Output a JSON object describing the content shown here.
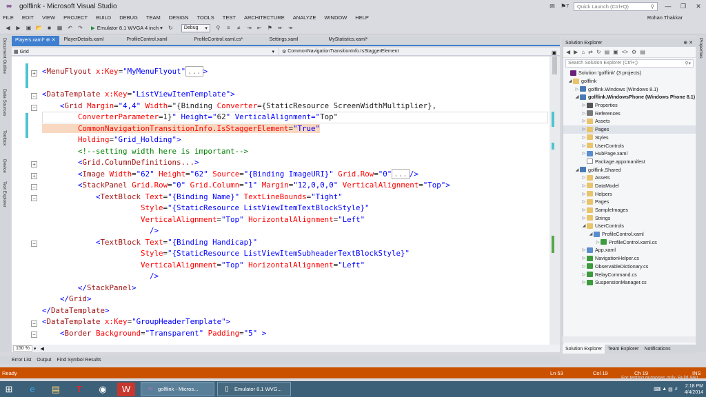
{
  "window": {
    "title": "golflink - Microsoft Visual Studio",
    "quick_launch_placeholder": "Quick Launch (Ctrl+Q)",
    "notification_count": "7",
    "user": "Rohan Thakkar"
  },
  "menu": [
    "FILE",
    "EDIT",
    "VIEW",
    "PROJECT",
    "BUILD",
    "DEBUG",
    "TEAM",
    "DESIGN",
    "TOOLS",
    "TEST",
    "ARCHITECTURE",
    "ANALYZE",
    "WINDOW",
    "HELP"
  ],
  "toolbar": {
    "run_target": "Emulator 8.1 WVGA 4 inch",
    "configuration": "Debug"
  },
  "left_panels": [
    "Document Outline",
    "Data Sources",
    "Toolbox",
    "Device",
    "Test Explorer"
  ],
  "doc_tabs": [
    {
      "label": "Players.xaml*",
      "active": true
    },
    {
      "label": "PlayerDetails.xaml",
      "active": false
    },
    {
      "label": "ProfileControl.xaml",
      "active": false
    },
    {
      "label": "ProfileControl.xaml.cs*",
      "active": false
    },
    {
      "label": "Settings.xaml",
      "active": false
    },
    {
      "label": "MyStatistics.xaml*",
      "active": false
    }
  ],
  "navbar": {
    "element": "Grid",
    "member": "CommonNavigationTransitionInfo.IsStaggerElement"
  },
  "editor": {
    "zoom": "150 %",
    "lines": [
      "<MenuFlyout x:Key=\"MyMenuFlyout\"...>",
      "",
      "<DataTemplate x:Key=\"ListViewItemTemplate\">",
      "    <Grid Margin=\"4,4\" Width=\"{Binding Converter={StaticResource ScreenWidthMultiplier},",
      "        ConverterParameter=1}\" Height=\"62\" VerticalAlignment=\"Top\"",
      "        CommonNavigationTransitionInfo.IsStaggerElement=\"True\"",
      "        Holding=\"Grid_Holding\">",
      "        <!--setting width here is important-->",
      "        <Grid.ColumnDefinitions...>",
      "        <Image Width=\"62\" Height=\"62\" Source=\"{Binding ImageURI}\" Grid.Row=\"0\".../>",
      "        <StackPanel Grid.Row=\"0\" Grid.Column=\"1\" Margin=\"12,0,0,0\" VerticalAlignment=\"Top\">",
      "            <TextBlock Text=\"{Binding Name}\" TextLineBounds=\"Tight\"",
      "                      Style=\"{StaticResource ListViewItemTextBlockStyle}\"",
      "                      VerticalAlignment=\"Top\" HorizontalAlignment=\"Left\"",
      "                        />",
      "            <TextBlock Text=\"{Binding Handicap}\"",
      "                      Style=\"{StaticResource ListViewItemSubheaderTextBlockStyle}\"",
      "                      VerticalAlignment=\"Top\" HorizontalAlignment=\"Left\"",
      "                        />",
      "        </StackPanel>",
      "    </Grid>",
      "</DataTemplate>",
      "<DataTemplate x:Key=\"GroupHeaderTemplate\">",
      "    <Border Background=\"Transparent\" Padding=\"5\" >"
    ]
  },
  "output_tabs": [
    "Error List",
    "Output",
    "Find Symbol Results"
  ],
  "solution_explorer": {
    "title": "Solution Explorer",
    "search_placeholder": "Search Solution Explorer (Ctrl+;)",
    "items": [
      {
        "label": "Solution 'golflink' (3 projects)",
        "icon": "solution-icon"
      },
      {
        "label": "golflink",
        "icon": "project-icon"
      },
      {
        "label": "golflink.Windows (Windows 8.1)",
        "icon": "project-icon"
      },
      {
        "label": "golflink.WindowsPhone (Windows Phone 8.1)",
        "icon": "project-icon"
      },
      {
        "label": "Properties",
        "icon": "wrench-icon"
      },
      {
        "label": "References",
        "icon": "references-icon"
      },
      {
        "label": "Assets",
        "icon": "folder-icon"
      },
      {
        "label": "Pages",
        "icon": "folder-icon"
      },
      {
        "label": "Styles",
        "icon": "folder-icon"
      },
      {
        "label": "UserControls",
        "icon": "folder-icon"
      },
      {
        "label": "HubPage.xaml",
        "icon": "xaml-icon"
      },
      {
        "label": "Package.appxmanifest",
        "icon": "file-icon"
      },
      {
        "label": "golflink.Shared",
        "icon": "project-icon"
      },
      {
        "label": "Assets",
        "icon": "folder-icon"
      },
      {
        "label": "DataModel",
        "icon": "folder-icon"
      },
      {
        "label": "Helpers",
        "icon": "folder-icon"
      },
      {
        "label": "Pages",
        "icon": "folder-icon"
      },
      {
        "label": "SampleImages",
        "icon": "folder-icon"
      },
      {
        "label": "Strings",
        "icon": "folder-icon"
      },
      {
        "label": "UserControls",
        "icon": "folder-icon"
      },
      {
        "label": "ProfileControl.xaml",
        "icon": "xaml-icon"
      },
      {
        "label": "ProfileControl.xaml.cs",
        "icon": "cs-icon"
      },
      {
        "label": "App.xaml",
        "icon": "xaml-icon"
      },
      {
        "label": "NavigationHelper.cs",
        "icon": "cs-icon"
      },
      {
        "label": "ObservableDictionary.cs",
        "icon": "cs-icon"
      },
      {
        "label": "RelayCommand.cs",
        "icon": "cs-icon"
      },
      {
        "label": "SuspensionManager.cs",
        "icon": "cs-icon"
      }
    ],
    "tabs": [
      "Solution Explorer",
      "Team Explorer",
      "Notifications"
    ]
  },
  "right_panels": [
    "Properties"
  ],
  "status": {
    "state": "Ready",
    "line": "Ln 53",
    "col": "Col 19",
    "ch": "Ch 19",
    "mode": "INS"
  },
  "taskbar": {
    "apps": [
      "golflink - Micros...",
      "Emulator 8.1 WVG..."
    ],
    "time": "2:18 PM",
    "date": "4/4/2014",
    "watermark": "For testing purposes only. Build 960..."
  },
  "colors": {
    "statusbar": "#ca5100",
    "active_tab": "#3f7fcf",
    "taskbar": "#3c6077"
  }
}
